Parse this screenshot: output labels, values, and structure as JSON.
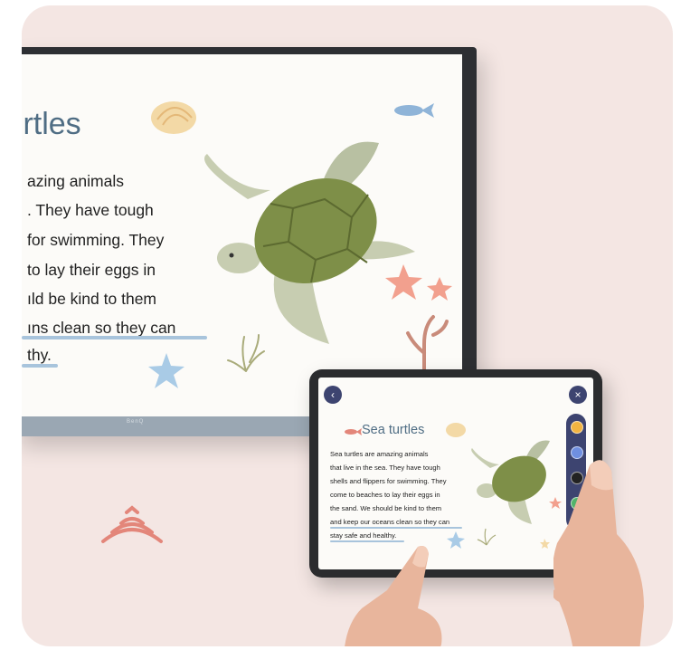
{
  "display": {
    "title": "ırtles",
    "lines": [
      "azing animals",
      ". They have tough",
      " for swimming. They",
      "to lay their eggs in",
      "ıld be kind to them",
      "ıns clean so they can",
      "thy."
    ],
    "brand": "BenQ"
  },
  "tablet": {
    "title": "Sea turtles",
    "lines": [
      "Sea turtles are amazing animals",
      "that live in the sea. They have tough",
      "shells and flippers for swimming. They",
      "come to beaches to lay their eggs in",
      "the sand. We should be kind to them",
      "and keep our oceans clean so they can",
      "stay safe and healthy."
    ],
    "back_icon": "chevron-left-icon",
    "close_icon": "close-icon",
    "pen_colors": [
      "#f2b441",
      "#6f8fe0",
      "#222222",
      "#52b36a"
    ]
  },
  "colors": {
    "background": "#f4e6e3",
    "title": "#4f6d84",
    "highlight": "#a8c4dc",
    "toolbar": "#3d4470",
    "wireless": "#e3867a"
  }
}
